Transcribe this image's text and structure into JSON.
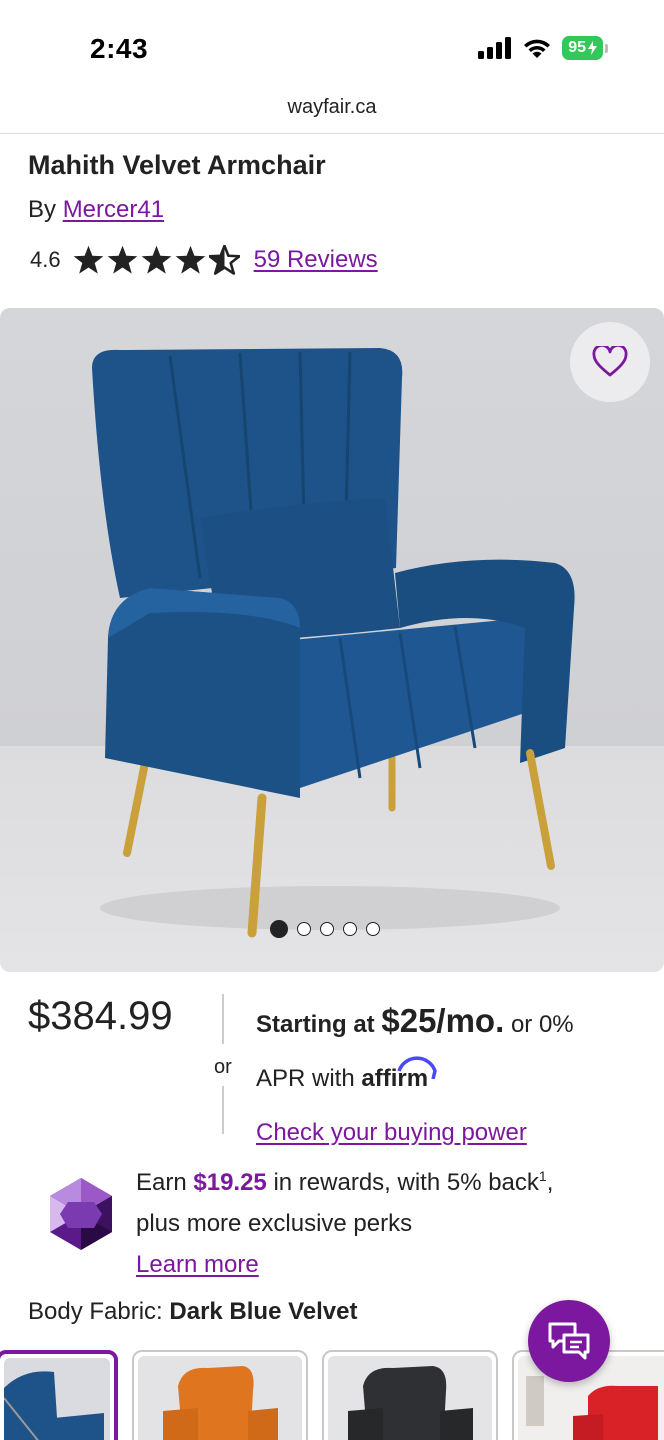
{
  "status_bar": {
    "time": "2:43",
    "battery": "95"
  },
  "browser": {
    "url": "wayfair.ca"
  },
  "product": {
    "title": "Mahith Velvet Armchair",
    "by_label": "By",
    "brand": "Mercer41",
    "rating": "4.6",
    "rating_stars": 4.6,
    "reviews_link": "59 Reviews",
    "image_count": 5,
    "current_image_index": 1
  },
  "pricing": {
    "price": "$384.99",
    "or_label": "or",
    "starting_at": "Starting at",
    "monthly": "$25/mo.",
    "or_apr_1": "or 0%",
    "apr_with": "APR with",
    "affirm": "affirm",
    "buying_power_link": "Check your buying power"
  },
  "rewards": {
    "earn": "Earn",
    "amount": "$19.25",
    "rest": "in rewards, with 5% back",
    "superscript": "1",
    "tail": ",",
    "line2": "plus more exclusive perks",
    "learn_more": "Learn more"
  },
  "options": {
    "label": "Body Fabric:",
    "selected": "Dark Blue Velvet",
    "swatches": [
      "Dark Blue Velvet",
      "Orange Velvet",
      "Black Velvet",
      "Red Velvet"
    ]
  },
  "colors": {
    "accent": "#7b189f",
    "chair_blue": "#1d5389",
    "leg_gold": "#c9a03a",
    "battery_green": "#34c759"
  }
}
